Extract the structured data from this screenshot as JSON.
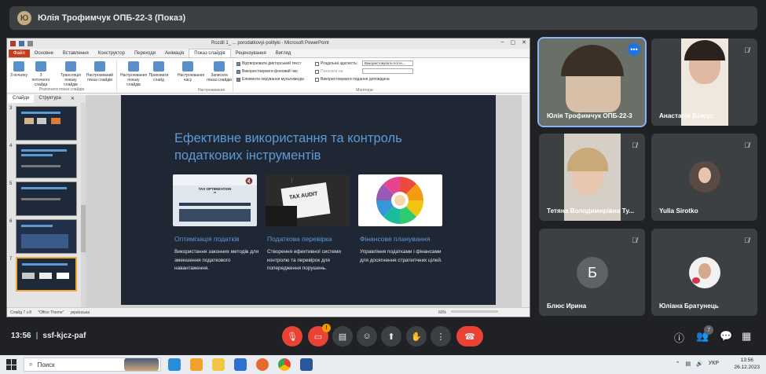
{
  "presenter_bar": {
    "avatar_letter": "Ю",
    "text": "Юлія Трофимчук ОПБ-22-3 (Показ)"
  },
  "ppt": {
    "window_title": "Rozdil 1_ ... porodatkovyi-polityki - Microsoft PowerPoint",
    "file_tab": "Файл",
    "tabs": [
      "Основне",
      "Вставлення",
      "Конструктор",
      "Переходи",
      "Анімація",
      "Показ слайдів",
      "Рецензування",
      "Вигляд"
    ],
    "active_tab": "Показ слайдів",
    "ribbon": {
      "btn_from_start": "З початку",
      "btn_from_current": "З поточного слайда",
      "btn_broadcast": "Трансляція показу слайдів",
      "btn_custom": "Настроюваний показ слайдів",
      "group_start_label": "Розпочати показ слайдів",
      "btn_setup": "Настроювання показу слайдів",
      "btn_hide": "Приховати слайд",
      "btn_rehearse": "Настроювання часу",
      "btn_record": "Записати показ слайдів",
      "chk_narration": "Відтворювати дикторський текст",
      "chk_timings": "Використовувати фоновий час",
      "chk_media": "Елементи керування мультимедіа",
      "group_setup_label": "Настроювання",
      "resolution_label": "Роздільна здатність:",
      "resolution_value": "Використовувати поточ...",
      "show_on_label": "Показати на:",
      "presenter_view": "Використовувати подання доповідача",
      "group_monitors_label": "Монітори"
    },
    "pane_tabs": [
      "Слайди",
      "Структура"
    ],
    "thumbnails": [
      {
        "num": "3",
        "selected": false
      },
      {
        "num": "4",
        "selected": false
      },
      {
        "num": "5",
        "selected": false
      },
      {
        "num": "6",
        "selected": false
      },
      {
        "num": "7",
        "selected": true
      }
    ],
    "slide": {
      "title": "Ефективне використання та контроль податкових інструментів",
      "cards": [
        {
          "heading": "Оптимізація податків",
          "text": "Використання законних методів для зменшення податкового навантаження.",
          "img_text_1": "TAX OPTIMIZATION",
          "img_text_2": "="
        },
        {
          "heading": "Податкова перевірка",
          "text": "Створення ефективної системи контролю та перевірок для попередження порушень.",
          "img_text_1": "TAX AUDIT"
        },
        {
          "heading": "Фінансове планування",
          "text": "Управління податками і фінансами для досягнення стратегічних цілей."
        }
      ]
    },
    "status": {
      "slide_info": "Слайд 7 з 8",
      "theme": "\"Office Theme\"",
      "language": "українська",
      "zoom": "60%"
    }
  },
  "participants": [
    {
      "name": "Юлія Трофимчук ОПБ-22-3",
      "muted": false,
      "active": true
    },
    {
      "name": "Анастасія Білоус",
      "muted": true
    },
    {
      "name": "Тетяна Володимирівна Ту...",
      "muted": true
    },
    {
      "name": "Yulia Sirotko",
      "muted": true
    },
    {
      "name": "Блюс Ирина",
      "muted": true,
      "letter": "Б"
    },
    {
      "name": "Юліана Братунець",
      "muted": true
    }
  ],
  "meet": {
    "time": "13:56",
    "meeting_code": "ssf-kjcz-paf",
    "badge": "!",
    "participant_count": "7"
  },
  "taskbar": {
    "search_placeholder": "Поиск",
    "lang": "УКР",
    "time": "13:56",
    "date": "26.12.2023"
  },
  "colors": {
    "slide_bg": "#1f2735",
    "slide_accent": "#5e9ad3",
    "meet_bg": "#202124",
    "end_call": "#ea4335"
  }
}
